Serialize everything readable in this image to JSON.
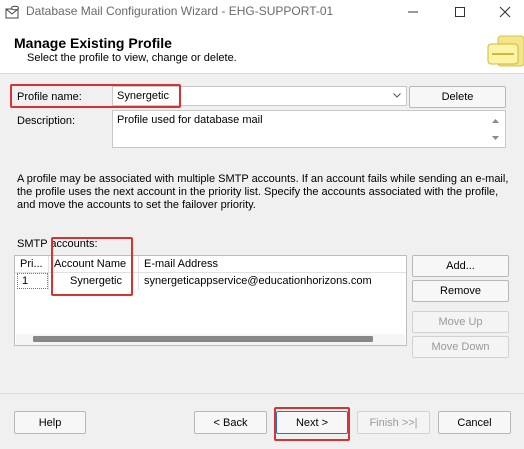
{
  "window": {
    "title": "Database Mail Configuration Wizard - EHG-SUPPORT-01"
  },
  "header": {
    "title": "Manage Existing Profile",
    "subtitle": "Select the profile to view, change or delete."
  },
  "profile": {
    "name_label": "Profile name:",
    "name_value": "Synergetic",
    "delete_label": "Delete",
    "description_label": "Description:",
    "description_value": "Profile used for database mail"
  },
  "info_text": "A profile may be associated with multiple SMTP accounts. If an account fails while sending an e-mail, the profile uses the next account in the priority list. Specify the accounts associated with the profile, and move the accounts to set the failover priority.",
  "smtp": {
    "label": "SMTP accounts:",
    "columns": [
      "Pri...",
      "Account Name",
      "E-mail Address"
    ],
    "rows": [
      {
        "priority": "1",
        "account_name": "Synergetic",
        "email": "synergeticappservice@educationhorizons.com"
      }
    ],
    "add_label": "Add...",
    "remove_label": "Remove",
    "move_up_label": "Move Up",
    "move_down_label": "Move Down"
  },
  "footer": {
    "help_label": "Help",
    "back_label": "< Back",
    "next_label": "Next >",
    "finish_label": "Finish >>|",
    "cancel_label": "Cancel"
  },
  "colors": {
    "highlight": "#d73333",
    "window_bg": "#f0f0f0"
  }
}
